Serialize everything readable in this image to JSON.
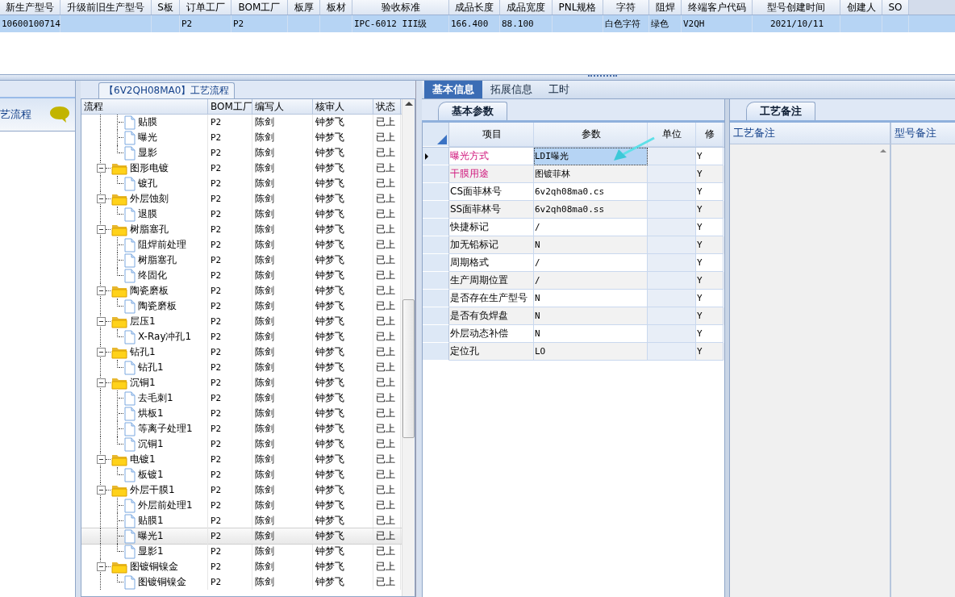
{
  "top_table": {
    "columns": [
      "新生产型号",
      "升级前旧生产型号",
      "S板",
      "订单工厂",
      "BOM工厂",
      "板厚",
      "板材",
      "验收标准",
      "成品长度",
      "成品宽度",
      "PNL规格",
      "字符",
      "阻焊",
      "终端客户代码",
      "型号创建时间",
      "创建人",
      "SO"
    ],
    "rows": [
      {
        "selected": true,
        "cells": [
          "10600100714",
          null,
          null,
          "P2",
          "P2",
          null,
          null,
          "IPC-6012 III级",
          "166.400",
          "88.100",
          null,
          "白色字符",
          "绿色",
          "V2QH",
          "2021/10/11",
          null,
          null
        ]
      }
    ]
  },
  "left_panel": {
    "title": "艺流程"
  },
  "process_group": {
    "title": "【6V2QH08MA0】工艺流程"
  },
  "process_tree": {
    "columns": [
      "流程",
      "BOM工厂",
      "编写人",
      "核审人",
      "状态"
    ],
    "items": [
      {
        "children": [
          {
            "label": "贴膜",
            "bom_factory": "P2",
            "writer": "陈剑",
            "reviewer": "钟梦飞",
            "status": "已上",
            "selected": false
          },
          {
            "label": "曝光",
            "bom_factory": "P2",
            "writer": "陈剑",
            "reviewer": "钟梦飞",
            "status": "已上",
            "selected": false
          },
          {
            "label": "显影",
            "bom_factory": "P2",
            "writer": "陈剑",
            "reviewer": "钟梦飞",
            "status": "已上",
            "selected": false
          }
        ]
      },
      {
        "label": "图形电镀",
        "bom_factory": "P2",
        "writer": "陈剑",
        "reviewer": "钟梦飞",
        "status": "已上",
        "selected": false,
        "expanded": true,
        "children": [
          {
            "label": "镀孔",
            "bom_factory": "P2",
            "writer": "陈剑",
            "reviewer": "钟梦飞",
            "status": "已上",
            "selected": false
          }
        ]
      },
      {
        "label": "外层蚀刻",
        "bom_factory": "P2",
        "writer": "陈剑",
        "reviewer": "钟梦飞",
        "status": "已上",
        "selected": false,
        "expanded": true,
        "children": [
          {
            "label": "退膜",
            "bom_factory": "P2",
            "writer": "陈剑",
            "reviewer": "钟梦飞",
            "status": "已上",
            "selected": false
          }
        ]
      },
      {
        "label": "树脂塞孔",
        "bom_factory": "P2",
        "writer": "陈剑",
        "reviewer": "钟梦飞",
        "status": "已上",
        "selected": false,
        "expanded": true,
        "children": [
          {
            "label": "阻焊前处理",
            "bom_factory": "P2",
            "writer": "陈剑",
            "reviewer": "钟梦飞",
            "status": "已上",
            "selected": false
          },
          {
            "label": "树脂塞孔",
            "bom_factory": "P2",
            "writer": "陈剑",
            "reviewer": "钟梦飞",
            "status": "已上",
            "selected": false
          },
          {
            "label": "终固化",
            "bom_factory": "P2",
            "writer": "陈剑",
            "reviewer": "钟梦飞",
            "status": "已上",
            "selected": false
          }
        ]
      },
      {
        "label": "陶瓷磨板",
        "bom_factory": "P2",
        "writer": "陈剑",
        "reviewer": "钟梦飞",
        "status": "已上",
        "selected": false,
        "expanded": true,
        "children": [
          {
            "label": "陶瓷磨板",
            "bom_factory": "P2",
            "writer": "陈剑",
            "reviewer": "钟梦飞",
            "status": "已上",
            "selected": false
          }
        ]
      },
      {
        "label": "层压1",
        "bom_factory": "P2",
        "writer": "陈剑",
        "reviewer": "钟梦飞",
        "status": "已上",
        "selected": false,
        "expanded": true,
        "children": [
          {
            "label": "X-Ray冲孔1",
            "bom_factory": "P2",
            "writer": "陈剑",
            "reviewer": "钟梦飞",
            "status": "已上",
            "selected": false
          }
        ]
      },
      {
        "label": "钻孔1",
        "bom_factory": "P2",
        "writer": "陈剑",
        "reviewer": "钟梦飞",
        "status": "已上",
        "selected": false,
        "expanded": true,
        "children": [
          {
            "label": "钻孔1",
            "bom_factory": "P2",
            "writer": "陈剑",
            "reviewer": "钟梦飞",
            "status": "已上",
            "selected": false
          }
        ]
      },
      {
        "label": "沉铜1",
        "bom_factory": "P2",
        "writer": "陈剑",
        "reviewer": "钟梦飞",
        "status": "已上",
        "selected": false,
        "expanded": true,
        "children": [
          {
            "label": "去毛刺1",
            "bom_factory": "P2",
            "writer": "陈剑",
            "reviewer": "钟梦飞",
            "status": "已上",
            "selected": false
          },
          {
            "label": "烘板1",
            "bom_factory": "P2",
            "writer": "陈剑",
            "reviewer": "钟梦飞",
            "status": "已上",
            "selected": false
          },
          {
            "label": "等离子处理1",
            "bom_factory": "P2",
            "writer": "陈剑",
            "reviewer": "钟梦飞",
            "status": "已上",
            "selected": false
          },
          {
            "label": "沉铜1",
            "bom_factory": "P2",
            "writer": "陈剑",
            "reviewer": "钟梦飞",
            "status": "已上",
            "selected": false
          }
        ]
      },
      {
        "label": "电镀1",
        "bom_factory": "P2",
        "writer": "陈剑",
        "reviewer": "钟梦飞",
        "status": "已上",
        "selected": false,
        "expanded": true,
        "children": [
          {
            "label": "板镀1",
            "bom_factory": "P2",
            "writer": "陈剑",
            "reviewer": "钟梦飞",
            "status": "已上",
            "selected": false
          }
        ]
      },
      {
        "label": "外层干膜1",
        "bom_factory": "P2",
        "writer": "陈剑",
        "reviewer": "钟梦飞",
        "status": "已上",
        "selected": false,
        "expanded": true,
        "children": [
          {
            "label": "外层前处理1",
            "bom_factory": "P2",
            "writer": "陈剑",
            "reviewer": "钟梦飞",
            "status": "已上",
            "selected": false
          },
          {
            "label": "贴膜1",
            "bom_factory": "P2",
            "writer": "陈剑",
            "reviewer": "钟梦飞",
            "status": "已上",
            "selected": false
          },
          {
            "label": "曝光1",
            "bom_factory": "P2",
            "writer": "陈剑",
            "reviewer": "钟梦飞",
            "status": "已上",
            "selected": true
          },
          {
            "label": "显影1",
            "bom_factory": "P2",
            "writer": "陈剑",
            "reviewer": "钟梦飞",
            "status": "已上",
            "selected": false
          }
        ]
      },
      {
        "label": "图镀铜镍金",
        "bom_factory": "P2",
        "writer": "陈剑",
        "reviewer": "钟梦飞",
        "status": "已上",
        "selected": false,
        "expanded": true,
        "children": [
          {
            "label": "图镀铜镍金",
            "bom_factory": "P2",
            "writer": "陈剑",
            "reviewer": "钟梦飞",
            "status": "已上",
            "selected": false
          }
        ]
      }
    ]
  },
  "detail_tabs": [
    {
      "label": "基本信息",
      "selected": true
    },
    {
      "label": "拓展信息",
      "selected": false
    },
    {
      "label": "工时",
      "selected": false
    }
  ],
  "params_panel": {
    "tab": "基本参数",
    "columns": [
      "项目",
      "参数",
      "单位",
      "修"
    ],
    "rows": [
      {
        "name": "曝光方式",
        "value": "LDI曝光",
        "modified": "Y",
        "highlight": true,
        "current": true
      },
      {
        "name": "干膜用途",
        "value": "图镀菲林",
        "modified": "Y",
        "highlight": true,
        "current": false
      },
      {
        "name": "CS面菲林号",
        "value": "6v2qh08ma0.cs",
        "modified": "Y",
        "highlight": false,
        "current": false
      },
      {
        "name": "SS面菲林号",
        "value": "6v2qh08ma0.ss",
        "modified": "Y",
        "highlight": false,
        "current": false
      },
      {
        "name": "快捷标记",
        "value": "/",
        "modified": "Y",
        "highlight": false,
        "current": false
      },
      {
        "name": "加无铅标记",
        "value": "N",
        "modified": "Y",
        "highlight": false,
        "current": false
      },
      {
        "name": "周期格式",
        "value": "/",
        "modified": "Y",
        "highlight": false,
        "current": false
      },
      {
        "name": "生产周期位置",
        "value": "/",
        "modified": "Y",
        "highlight": false,
        "current": false
      },
      {
        "name": "是否存在生产型号",
        "value": "N",
        "modified": "Y",
        "highlight": false,
        "current": false
      },
      {
        "name": "是否有负焊盘",
        "value": "N",
        "modified": "Y",
        "highlight": false,
        "current": false
      },
      {
        "name": "外层动态补偿",
        "value": "N",
        "modified": "Y",
        "highlight": false,
        "current": false
      },
      {
        "name": "定位孔",
        "value": "LO",
        "modified": "Y",
        "highlight": false,
        "current": false
      }
    ]
  },
  "notes_panel": {
    "tab": "工艺备注",
    "columns": [
      "工艺备注",
      "型号备注"
    ]
  }
}
